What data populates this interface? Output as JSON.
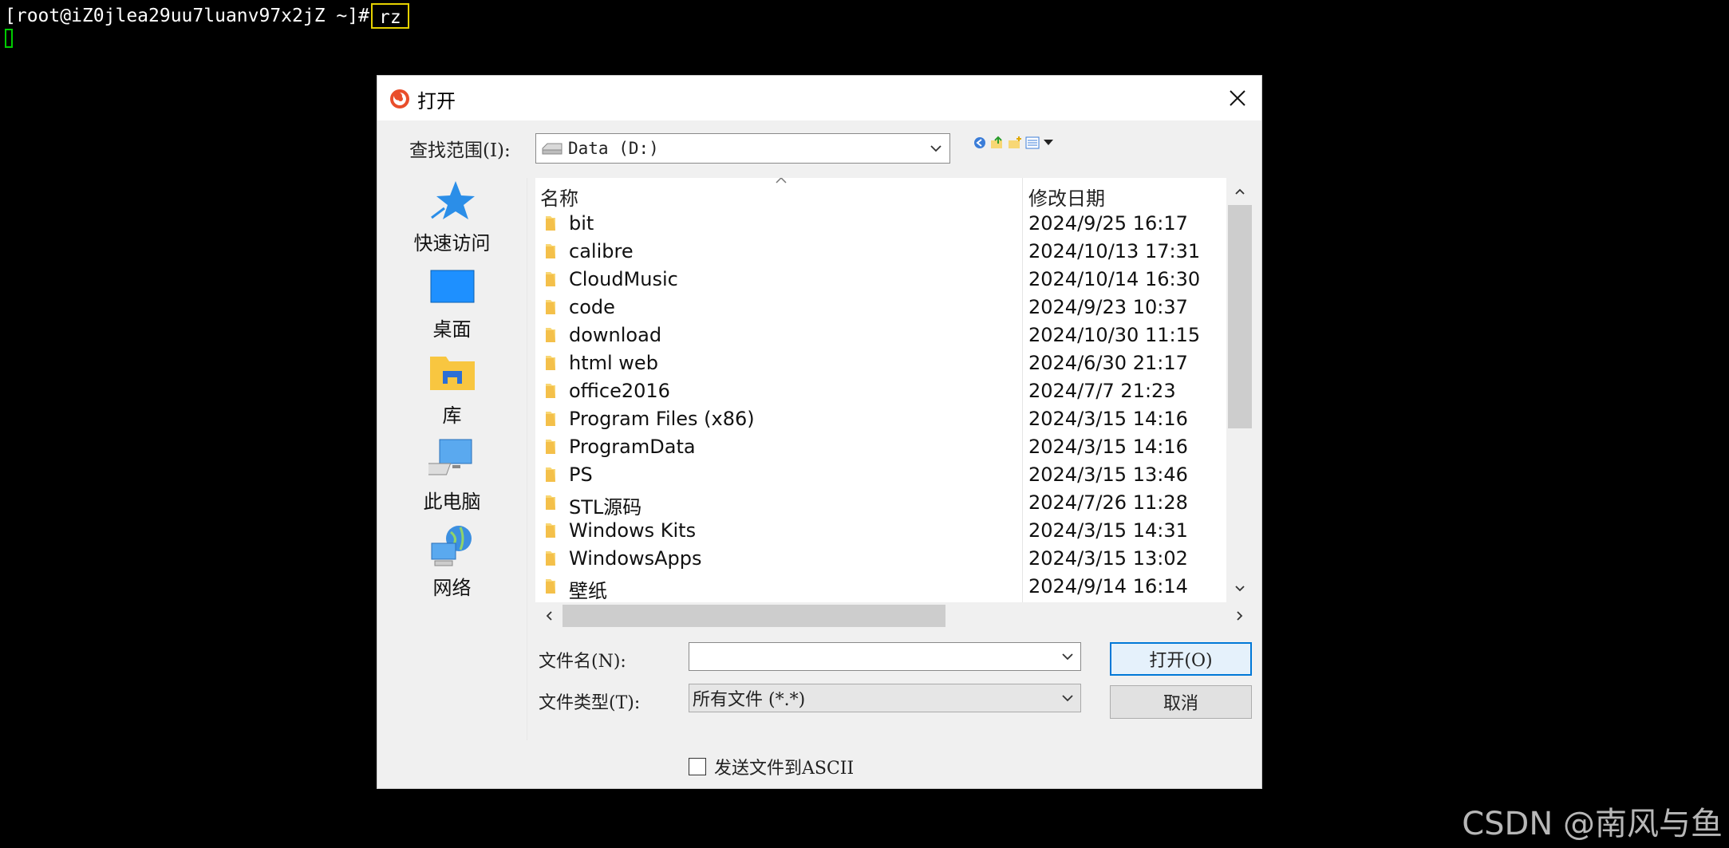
{
  "terminal": {
    "prompt": "[root@iZ0jlea29uu7luanv97x2jZ ~]#",
    "command": "rz"
  },
  "dialog": {
    "title": "打开",
    "look_in_label": "查找范围(I):",
    "look_in_value": "Data (D:)",
    "places": [
      {
        "label": "快速访问",
        "icon": "star-icon"
      },
      {
        "label": "桌面",
        "icon": "desktop-icon"
      },
      {
        "label": "库",
        "icon": "library-icon"
      },
      {
        "label": "此电脑",
        "icon": "computer-icon"
      },
      {
        "label": "网络",
        "icon": "network-icon"
      }
    ],
    "columns": {
      "name": "名称",
      "date": "修改日期"
    },
    "files": [
      {
        "name": "bit",
        "date": "2024/9/25 16:17"
      },
      {
        "name": "calibre",
        "date": "2024/10/13 17:31"
      },
      {
        "name": "CloudMusic",
        "date": "2024/10/14 16:30"
      },
      {
        "name": "code",
        "date": "2024/9/23 10:37"
      },
      {
        "name": "download",
        "date": "2024/10/30 11:15"
      },
      {
        "name": "html web",
        "date": "2024/6/30 21:17"
      },
      {
        "name": "office2016",
        "date": "2024/7/7 21:23"
      },
      {
        "name": "Program Files (x86)",
        "date": "2024/3/15 14:16"
      },
      {
        "name": "ProgramData",
        "date": "2024/3/15 14:16"
      },
      {
        "name": "PS",
        "date": "2024/3/15 13:46"
      },
      {
        "name": "STL源码",
        "date": "2024/7/26 11:28"
      },
      {
        "name": "Windows Kits",
        "date": "2024/3/15 14:31"
      },
      {
        "name": "WindowsApps",
        "date": "2024/3/15 13:02"
      },
      {
        "name": "壁纸",
        "date": "2024/9/14 16:14"
      }
    ],
    "filename_label": "文件名(N):",
    "filename_value": "",
    "filetype_label": "文件类型(T):",
    "filetype_value": "所有文件 (*.*)",
    "open_button": "打开(O)",
    "cancel_button": "取消",
    "send_ascii_label": "发送文件到ASCII"
  },
  "watermark": "CSDN @南风与鱼",
  "colors": {
    "folder": "#f8d775",
    "accent": "#0078d7",
    "cmd_highlight": "#e6d200",
    "cursor": "#00cc00"
  }
}
